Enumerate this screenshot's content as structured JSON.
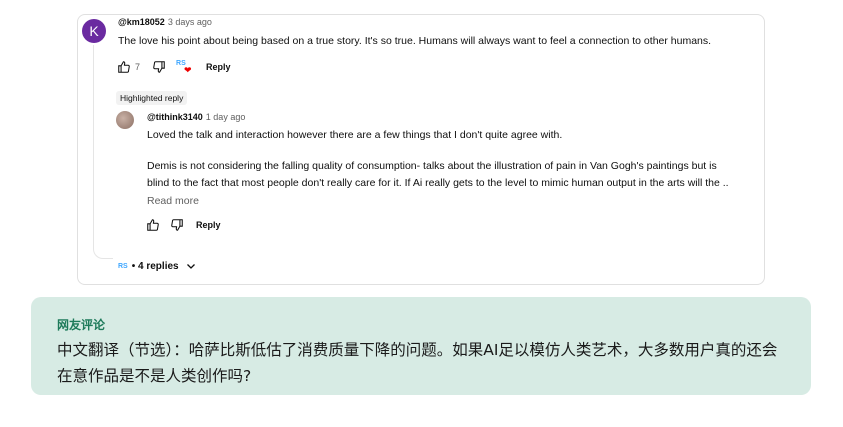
{
  "comment": {
    "avatar_letter": "K",
    "author": "@km18052",
    "time": "3 days ago",
    "text": "The love his point about being based on a true story. It's so true. Humans will always want to feel a connection to other humans.",
    "likes": "7",
    "reply_label": "Reply"
  },
  "highlighted_label": "Highlighted reply",
  "reply": {
    "author": "@tithink3140",
    "time": "1 day ago",
    "line1": "Loved the talk and interaction however there are a few things that I don't quite agree with.",
    "line2": "Demis is not considering the falling quality of consumption- talks about the illustration of pain in Van Gogh's paintings but is",
    "line3": "blind to the fact that most people don't really care for it. If Ai really gets to the level to mimic human output in the arts will the ..",
    "read_more": "Read more",
    "reply_label": "Reply"
  },
  "replies_toggle": {
    "badge": "RS",
    "label": "• 4 replies"
  },
  "note": {
    "title": "网友评论",
    "body": "中文翻译（节选）：哈萨比斯低估了消费质量下降的问题。如果AI足以模仿人类艺术，大多数用户真的还会在意作品是不是人类创作吗?"
  }
}
